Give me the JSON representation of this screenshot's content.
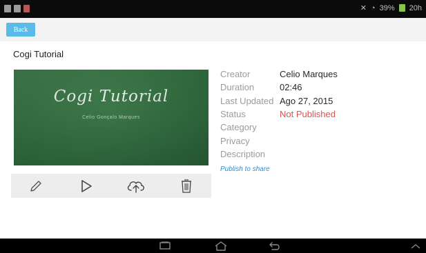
{
  "status_bar": {
    "left_icons": [
      "gallery-icon",
      "screenshot-icon",
      "app-notification-icon"
    ],
    "right_text": "20h",
    "signal_text": "39%",
    "icons": [
      "mute-icon",
      "wifi-icon",
      "battery-icon"
    ]
  },
  "toolbar": {
    "back_label": "Back"
  },
  "page": {
    "title": "Cogi Tutorial"
  },
  "thumbnail": {
    "title": "Cogi Tutorial",
    "subtitle": "Celio Gonçalo Marques"
  },
  "details": [
    {
      "label": "Creator",
      "value": "Celio Marques"
    },
    {
      "label": "Duration",
      "value": "02:46"
    },
    {
      "label": "Last Updated",
      "value": "Ago 27, 2015"
    },
    {
      "label": "Status",
      "value": "Not Published"
    },
    {
      "label": "Category",
      "value": ""
    },
    {
      "label": "Privacy",
      "value": ""
    },
    {
      "label": "Description",
      "value": ""
    }
  ],
  "publish_link": "Publish to share",
  "actions": [
    "edit-icon",
    "play-icon",
    "upload-icon",
    "delete-icon"
  ],
  "colors": {
    "accent": "#5bbbe8",
    "status_red": "#d9534f",
    "link_blue": "#2b8fd6",
    "chalkboard": "#2f6e3d"
  },
  "nav_bar": [
    "recent-apps-icon",
    "home-icon",
    "back-icon",
    "chevron-up-icon"
  ]
}
